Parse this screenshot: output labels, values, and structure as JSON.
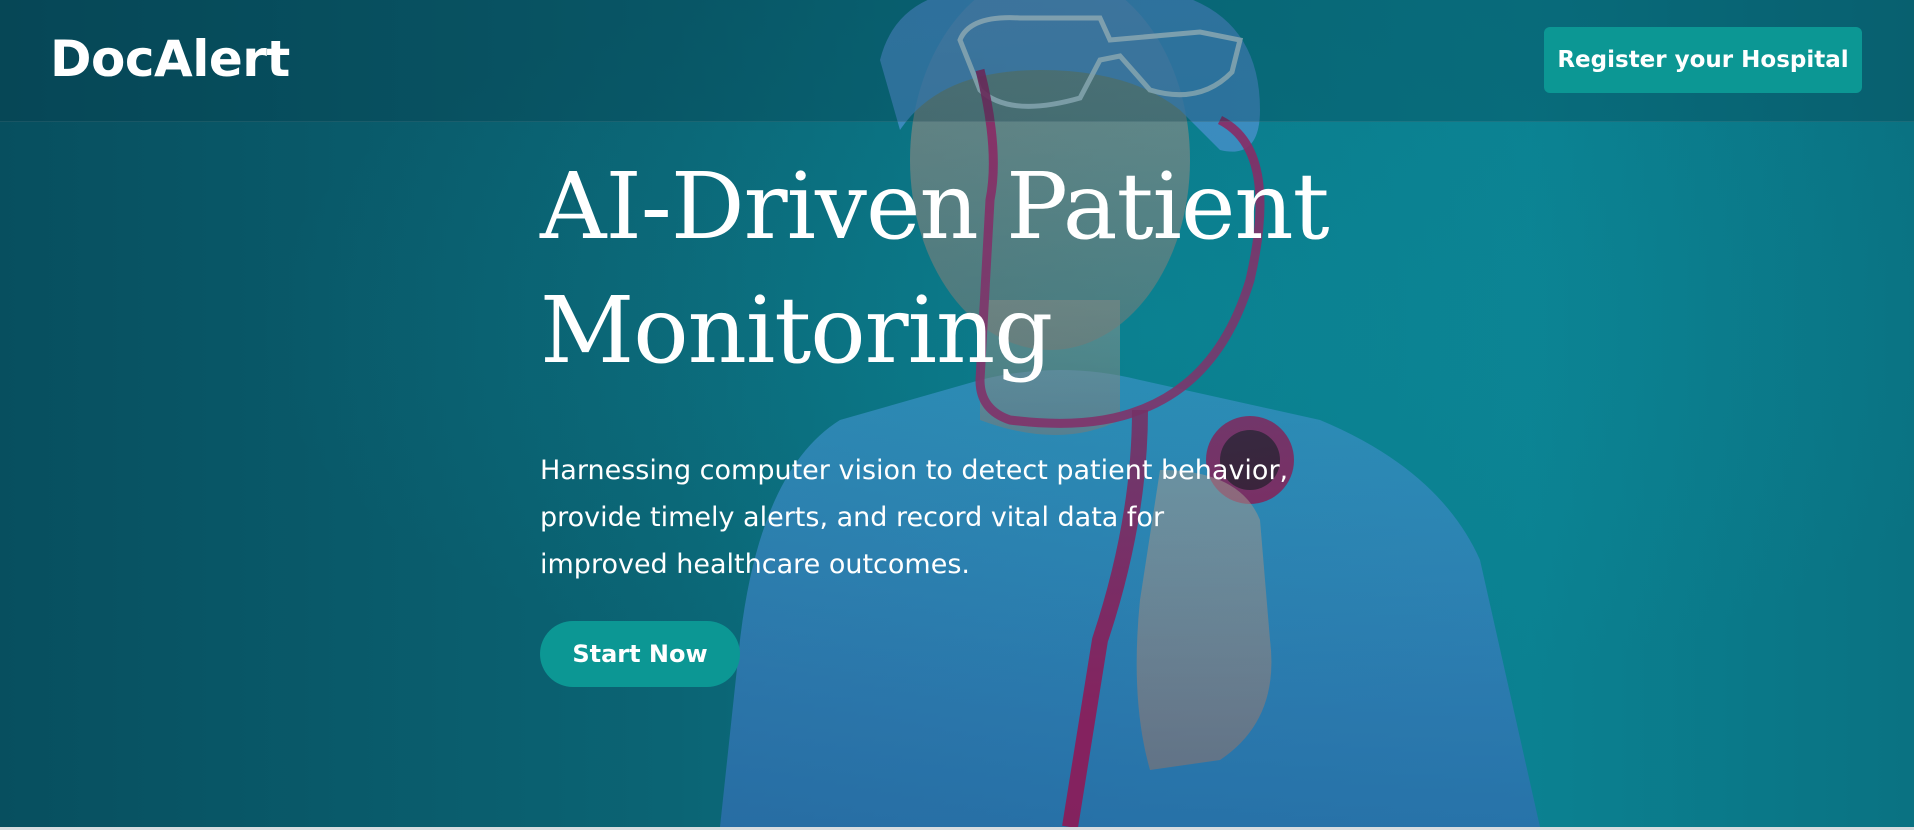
{
  "header": {
    "brand": "DocAlert",
    "register_label": "Register your Hospital"
  },
  "hero": {
    "headline_line1": "AI-Driven Patient",
    "headline_line2": "Monitoring",
    "subtext": "Harnessing computer vision to detect patient behavior, provide timely alerts, and record vital data for improved healthcare outcomes.",
    "cta_label": "Start Now",
    "image": "doctor-with-stethoscope-photo"
  },
  "colors": {
    "overlay": "#0b6474",
    "accent": "#0c9794",
    "text": "#ffffff"
  }
}
